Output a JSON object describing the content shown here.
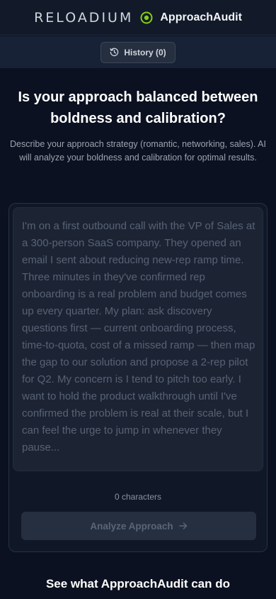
{
  "header": {
    "brand_wordmark": "RELOADIUM",
    "app_name": "ApproachAudit",
    "accent_color": "#84cc16"
  },
  "history": {
    "label": "History (0)"
  },
  "hero": {
    "headline": "Is your approach balanced between boldness and calibration?",
    "description": "Describe your approach strategy (romantic, networking, sales). AI will analyze your boldness and calibration for optimal results."
  },
  "form": {
    "placeholder": "I'm on a first outbound call with the VP of Sales at a 300-person SaaS company. They opened an email I sent about reducing new-rep ramp time. Three minutes in they've confirmed rep onboarding is a real problem and budget comes up every quarter. My plan: ask discovery questions first — current onboarding process, time-to-quota, cost of a missed ramp — then map the gap to our solution and propose a 2-rep pilot for Q2. My concern is I tend to pitch too early. I want to hold the product walkthrough until I've confirmed the problem is real at their scale, but I can feel the urge to jump in whenever they pause...",
    "value": "",
    "char_count": "0 characters",
    "submit_label": "Analyze Approach",
    "submit_disabled": true
  },
  "features": {
    "heading": "See what ApproachAudit can do"
  }
}
